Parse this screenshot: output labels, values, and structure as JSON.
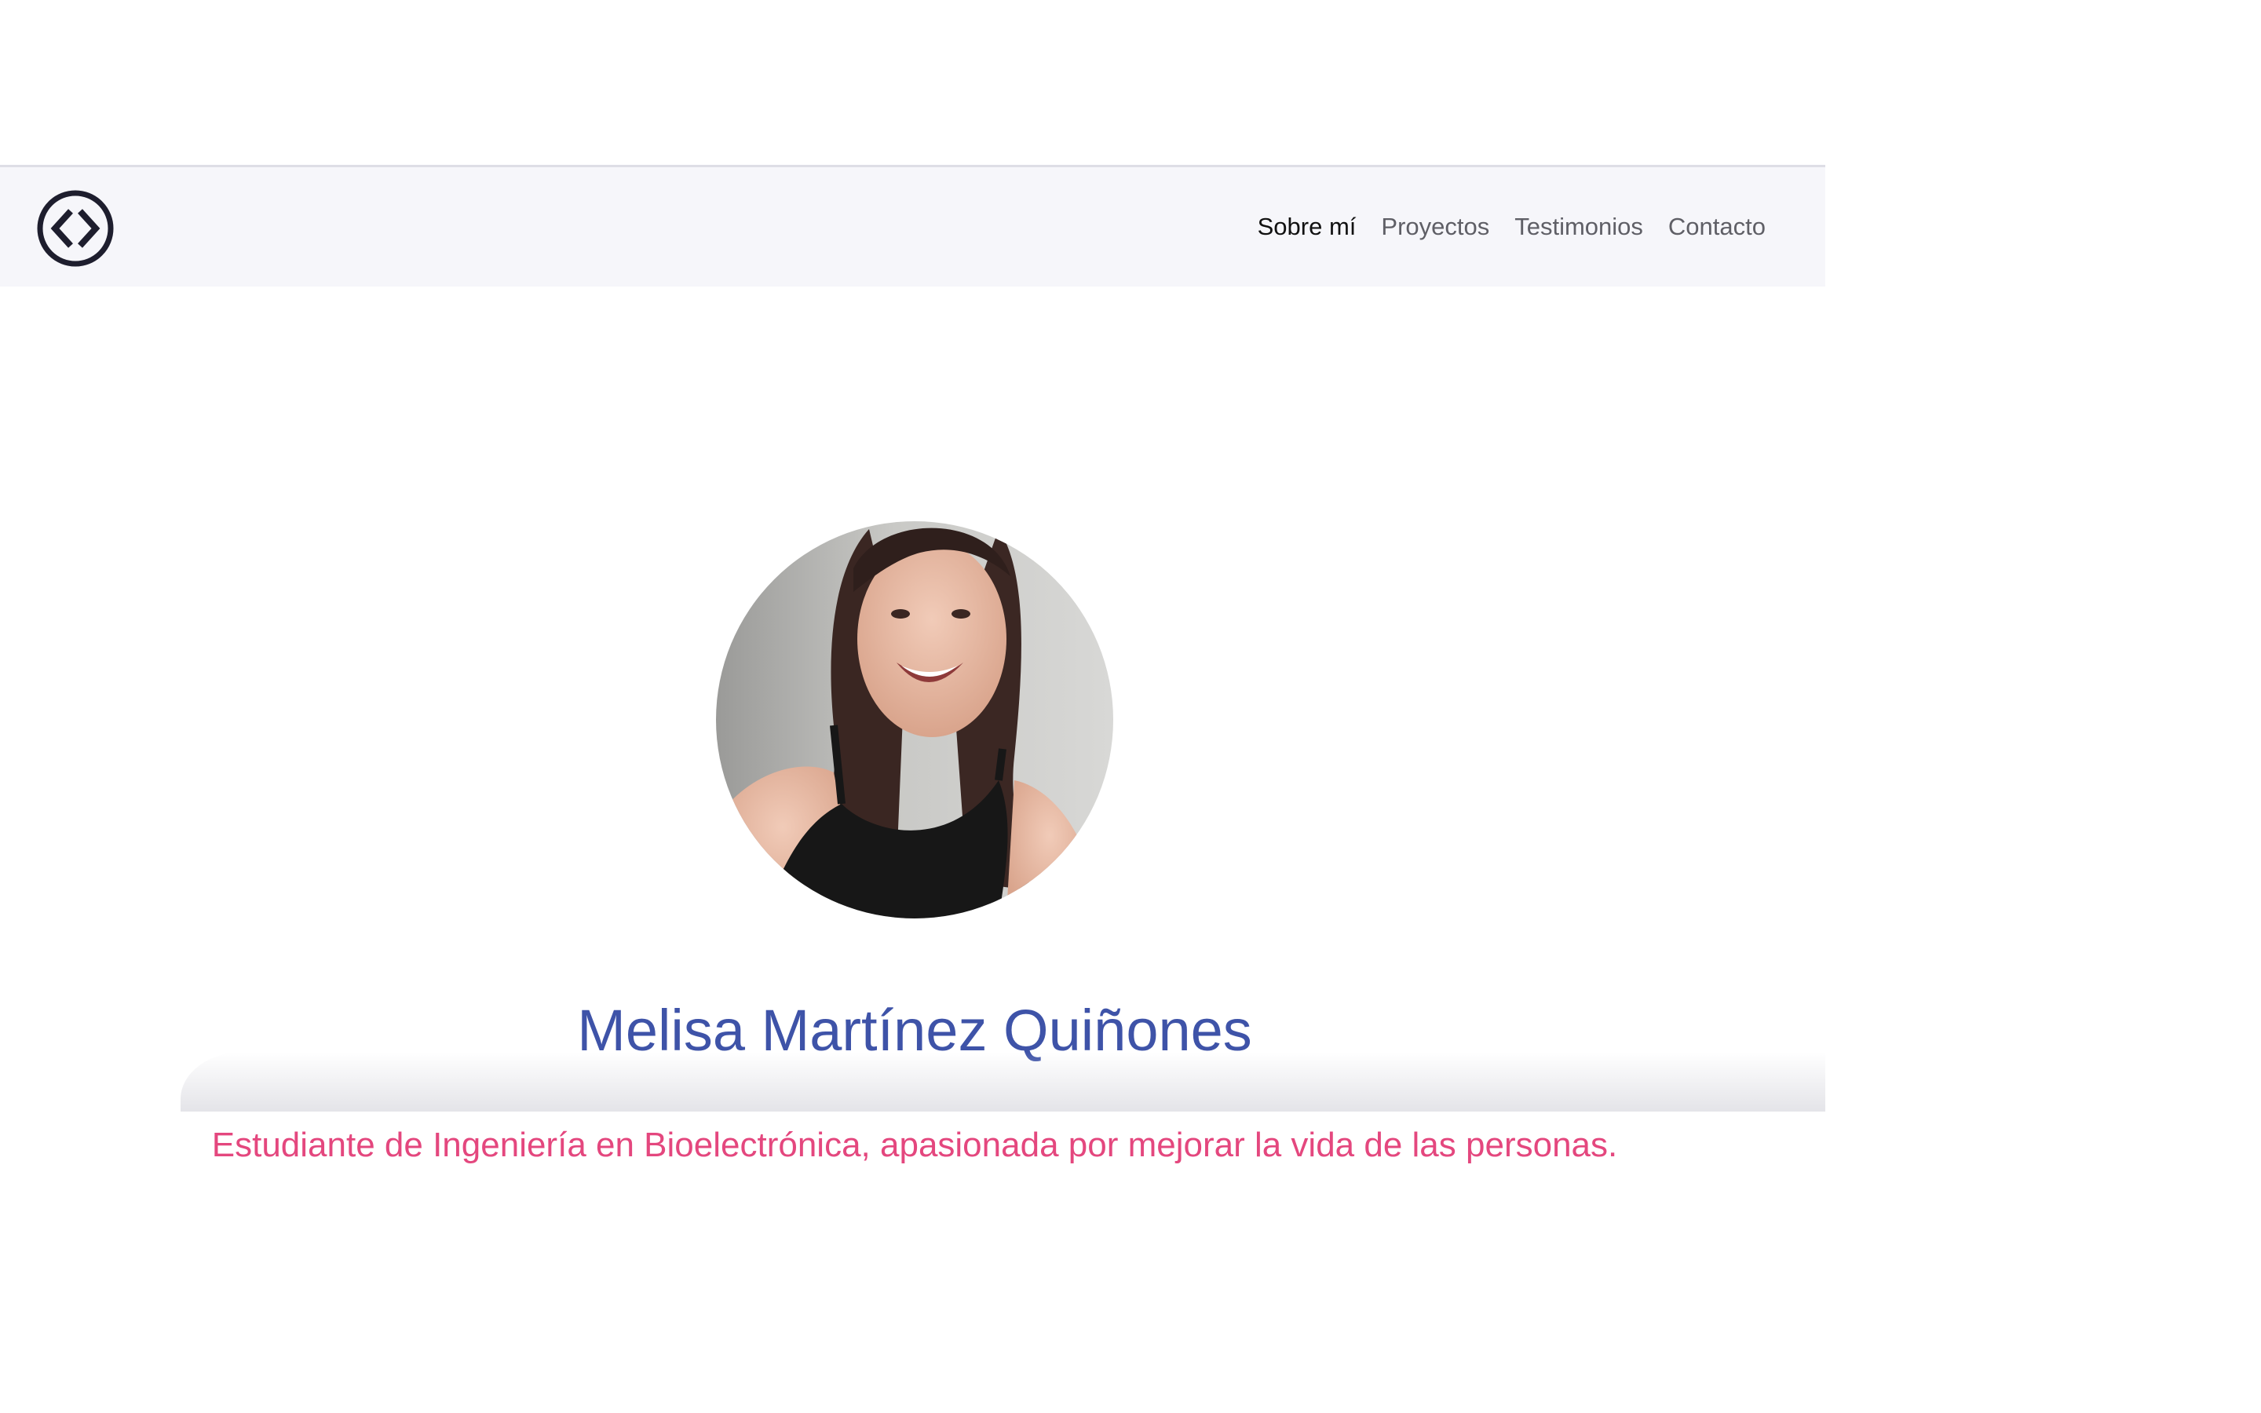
{
  "header": {
    "logo_icon": "code-brackets-circle-icon",
    "nav": [
      {
        "label": "Sobre mí",
        "active": true
      },
      {
        "label": "Proyectos",
        "active": false
      },
      {
        "label": "Testimonios",
        "active": false
      },
      {
        "label": "Contacto",
        "active": false
      }
    ]
  },
  "hero": {
    "photo": "profile-photo",
    "name": "Melisa Martínez Quiñones",
    "tagline": "Estudiante de Ingeniería en Bioelectrónica, apasionada por mejorar la vida de las personas."
  },
  "colors": {
    "navbar_bg": "#f6f6fa",
    "name": "#3e53a8",
    "tagline": "#e4477e",
    "logo": "#1e1e2e"
  }
}
